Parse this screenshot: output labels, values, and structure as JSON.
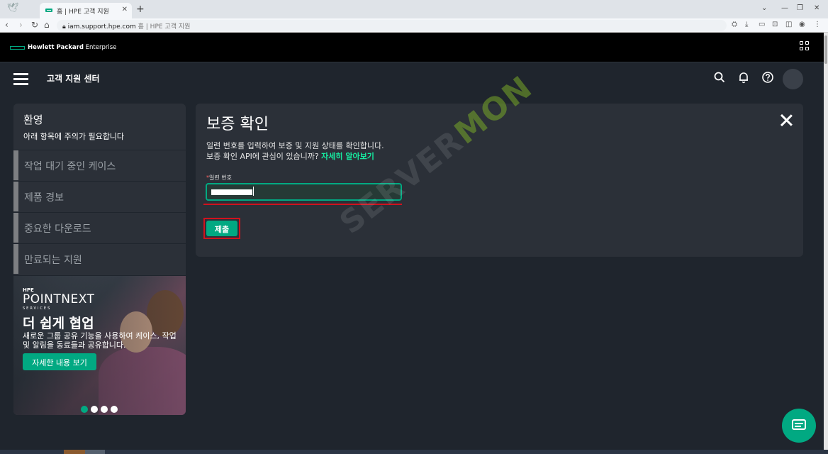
{
  "browser": {
    "tab_title": "홈 | HPE 고객 지원",
    "tab_close": "✕",
    "new_tab": "+",
    "url_host": "iam.support.hpe.com",
    "url_page_title": "홈 | HPE 고객 지원"
  },
  "hpe_bar": {
    "logo_bold": "Hewlett Packard",
    "logo_regular": " Enterprise"
  },
  "app_header": {
    "title": "고객 지원 센터"
  },
  "sidebar": {
    "title": "환영",
    "subtitle": "아래 항목에 주의가 필요합니다",
    "items": [
      {
        "label": "작업 대기 중인 케이스"
      },
      {
        "label": "제품 경보"
      },
      {
        "label": "중요한 다운로드"
      },
      {
        "label": "만료되는 지원"
      }
    ]
  },
  "promo": {
    "hpe": "HPE",
    "brand": "POINTNEXT",
    "services": "SERVICES",
    "headline": "더 쉽게 협업",
    "description": "새로운 그룹 공유 기능을 사용하여 케이스, 작업 및 알림을 동료들과 공유합니다.",
    "button_label": "자세한 내용 보기",
    "slide_count": 4,
    "active_slide": 1
  },
  "warranty_card": {
    "title": "보증 확인",
    "description_line1": "일련 번호를 입력하여 보증 및 지원 상태를 확인합니다.",
    "description_line2": "보증 확인 API에 관심이 있습니까? ",
    "learn_more_link": "자세히 알아보기",
    "field_required_mark": "*",
    "field_label": "일련 번호",
    "submit_label": "제출"
  },
  "watermark": {
    "text_plain": "SERVER",
    "text_accent": "MON"
  },
  "colors": {
    "accent": "#01a982",
    "link": "#17eba0",
    "highlight_red": "#d0121d",
    "background": "#1f252d",
    "panel": "#2b3038"
  }
}
